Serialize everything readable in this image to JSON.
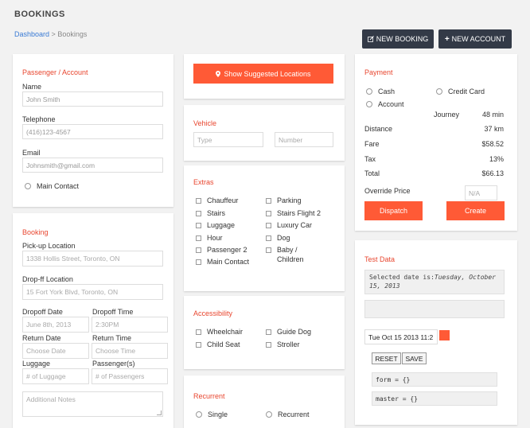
{
  "page": {
    "title": "BOOKINGS"
  },
  "breadcrumb": {
    "home": "Dashboard",
    "sep": ">",
    "current": "Bookings"
  },
  "toolbar": {
    "new_booking_icon": "edit-icon",
    "new_booking": "NEW BOOKING",
    "new_account_icon": "plus-icon",
    "new_account": "NEW ACCOUNT"
  },
  "passenger": {
    "title": "Passenger / Account",
    "name_label": "Name",
    "name_value": "John Smith",
    "phone_label": "Telephone",
    "phone_value": "(416)123-4567",
    "email_label": "Email",
    "email_value": "Johnsmith@gmail.com",
    "main_contact": "Main Contact"
  },
  "booking": {
    "title": "Booking",
    "pickup_label": "Pick-up Location",
    "pickup_value": "1338 Hollis Street, Toronto, ON",
    "dropoff_label": "Drop-ff Location",
    "dropoff_value": "15 Fort York Blvd, Toronto, ON",
    "dropoff_date_label": "Dropoff Date",
    "dropoff_date_value": "June 8th, 2013",
    "dropoff_time_label": "Dropoff Time",
    "dropoff_time_value": "2:30PM",
    "return_date_label": "Return Date",
    "return_date_placeholder": "Choose Date",
    "return_time_label": "Return Time",
    "return_time_placeholder": "Choose Time",
    "luggage_label": "Luggage",
    "luggage_placeholder": "# of Luggage",
    "passengers_label": "Passenger(s)",
    "passengers_placeholder": "# of Passengers",
    "notes_placeholder": "Additional Notes"
  },
  "locations": {
    "button": "Show Suggested Locations",
    "icon": "map-marker-icon"
  },
  "vehicle": {
    "title": "Vehicle",
    "type_placeholder": "Type",
    "number_placeholder": "Number"
  },
  "extras": {
    "title": "Extras",
    "col1": [
      "Chauffeur",
      "Stairs",
      "Luggage",
      "Hour",
      "Passenger 2",
      "Main Contact"
    ],
    "col2": [
      "Parking",
      "Stairs Flight 2",
      "Luxury Car",
      "Dog",
      "Baby /",
      "Children"
    ]
  },
  "accessibility": {
    "title": "Accessibility",
    "col1": [
      "Wheelchair",
      "Child Seat"
    ],
    "col2": [
      "Guide Dog",
      "Stroller"
    ]
  },
  "recurrent": {
    "title": "Recurrent",
    "single": "Single",
    "recurrent": "Recurrent"
  },
  "payment": {
    "title": "Payment",
    "cash": "Cash",
    "credit": "Credit Card",
    "account": "Account",
    "journey_label": "Journey",
    "journey_value": "48 min",
    "distance_label": "Distance",
    "distance_value": "37 km",
    "fare_label": "Fare",
    "fare_value": "$58.52",
    "tax_label": "Tax",
    "tax_value": "13%",
    "total_label": "Total",
    "total_value": "$66.13",
    "override_label": "Override Price",
    "override_placeholder": "N/A",
    "dispatch": "Dispatch",
    "create": "Create"
  },
  "testdata": {
    "title": "Test Data",
    "selected_prefix": "Selected date is:",
    "selected_value": "Tuesday, October 15, 2013",
    "date_input": "Tue Oct 15 2013 11:2",
    "reset": "RESET",
    "save": "SAVE",
    "form": "form = {}",
    "master": "master = {}"
  },
  "colors": {
    "accent": "#ff5a36",
    "section": "#e8462f",
    "dark": "#333a47"
  }
}
